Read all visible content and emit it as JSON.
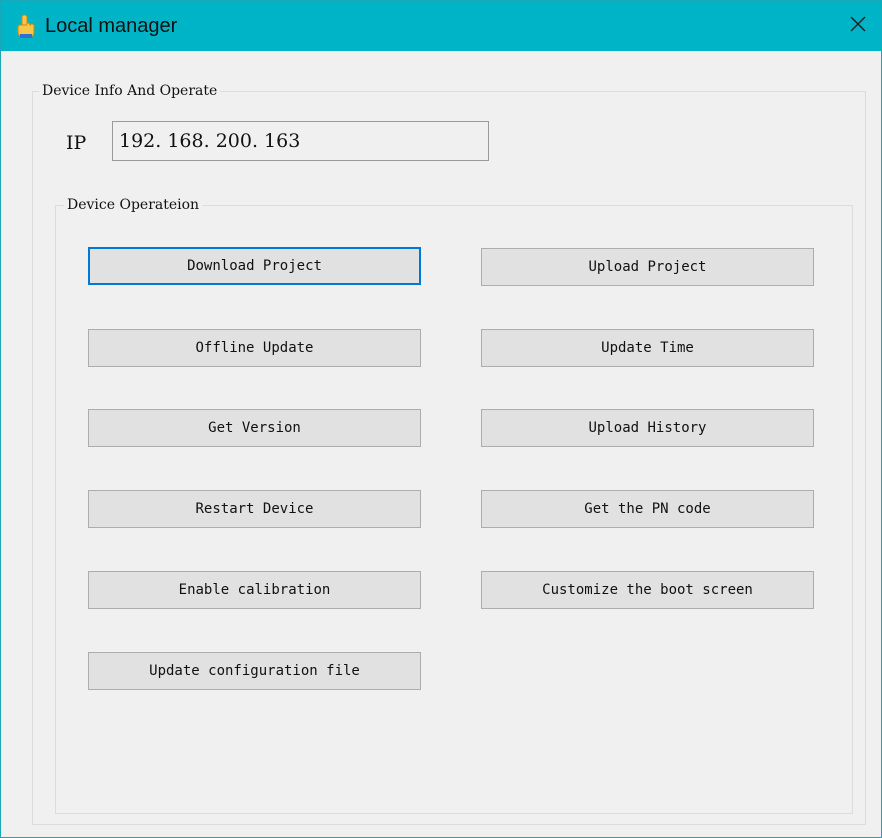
{
  "window": {
    "title": "Local manager",
    "close_glyph": "✕",
    "title_icon": "hand-pointer-icon"
  },
  "device_info": {
    "legend": "Device Info And Operate",
    "ip_label": "IP",
    "ip_value": "192. 168. 200. 163"
  },
  "device_operation": {
    "legend": "Device Operateion",
    "buttons": {
      "download_project": "Download Project",
      "upload_project": "Upload Project",
      "offline_update": "Offline Update",
      "update_time": "Update Time",
      "get_version": "Get Version",
      "upload_history": "Upload History",
      "restart_device": "Restart Device",
      "get_pn_code": "Get the PN code",
      "enable_calibration": "Enable calibration",
      "customize_boot_screen": "Customize the boot screen",
      "update_config_file": "Update configuration file"
    },
    "focused_button": "Download Project"
  },
  "colors": {
    "titlebar": "#00b4c8",
    "window_bg": "#f0f0f0",
    "button_bg": "#e1e1e1",
    "focus_border": "#0078d7"
  }
}
